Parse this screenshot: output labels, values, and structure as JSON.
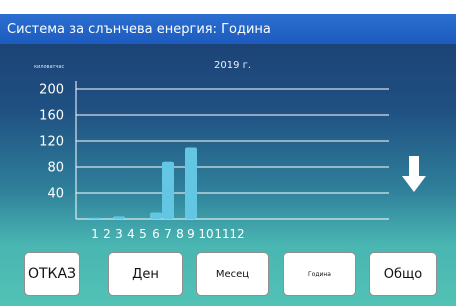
{
  "window": {
    "title": "Система за слънчева енергия: Година"
  },
  "chart_data": {
    "type": "bar",
    "title": "2019 г.",
    "ylabel": "киловатчас",
    "xlabel": "",
    "categories": [
      "1",
      "2",
      "3",
      "4",
      "5",
      "6",
      "7",
      "8",
      "9",
      "10",
      "11",
      "12"
    ],
    "values": [
      2,
      0,
      4,
      0,
      0,
      10,
      88,
      0,
      110,
      0,
      0,
      0
    ],
    "yticks": [
      40,
      80,
      120,
      160,
      200
    ],
    "ylim": [
      0,
      210
    ],
    "grid": true,
    "bar_color": "#63c7e3"
  },
  "buttons": {
    "cancel": "ОТКАЗ",
    "day": "Ден",
    "month": "Месец",
    "year": "Година",
    "total": "Общо"
  },
  "icons": {
    "scroll_down": "down-arrow-icon"
  }
}
